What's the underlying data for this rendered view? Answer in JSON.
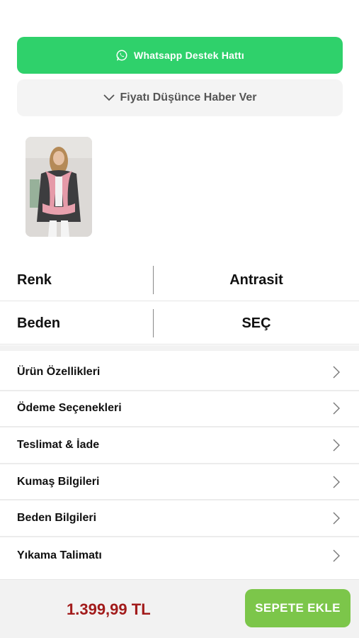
{
  "support": {
    "whatsapp_label": "Whatsapp Destek Hattı",
    "price_alert_label": "Fiyatı Düşünce Haber Ver",
    "colors": {
      "whatsapp_bg": "#2fd16b"
    }
  },
  "product": {
    "thumbnail_icon": "product-photo",
    "attributes": {
      "color": {
        "label": "Renk",
        "value": "Antrasit"
      },
      "size": {
        "label": "Beden",
        "value": "SEÇ"
      }
    }
  },
  "sections": [
    {
      "label": "Ürün Özellikleri"
    },
    {
      "label": "Ödeme Seçenekleri"
    },
    {
      "label": "Teslimat & İade"
    },
    {
      "label": "Kumaş Bilgileri"
    },
    {
      "label": "Beden Bilgileri"
    },
    {
      "label": "Yıkama Talimatı"
    }
  ],
  "footer": {
    "price": "1.399,99 TL",
    "add_to_cart_label": "SEPETE EKLE",
    "colors": {
      "price": "#a21b1b",
      "button": "#7cc64a"
    }
  }
}
